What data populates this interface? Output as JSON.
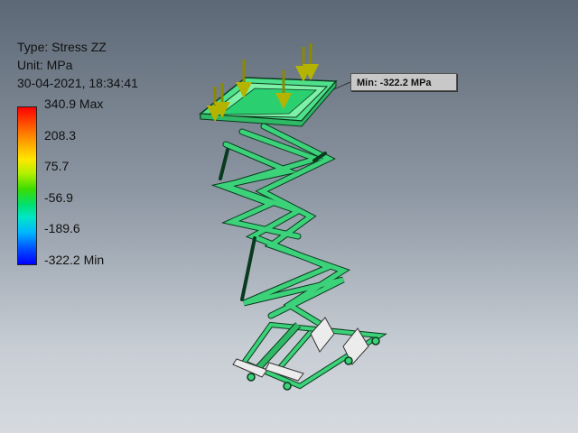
{
  "info": {
    "type": "Type: Stress ZZ",
    "unit": "Unit: MPa",
    "timestamp": "30-04-2021, 18:34:41"
  },
  "legend": {
    "labels": [
      "340.9 Max",
      "208.3",
      "75.7",
      "-56.9",
      "-189.6",
      "-322.2 Min"
    ],
    "colors": [
      "#ff0000",
      "#ffa000",
      "#ffe600",
      "#3cdc00",
      "#00e6c8",
      "#0050ff",
      "#0000ff"
    ]
  },
  "min_probe": {
    "label": "Min: -322.2 MPa"
  },
  "colors": {
    "frame": "#3cd27a",
    "frame_dark": "#0a3a1e",
    "load_arrow": "#b4b400",
    "plate": "#e8e8e8"
  }
}
